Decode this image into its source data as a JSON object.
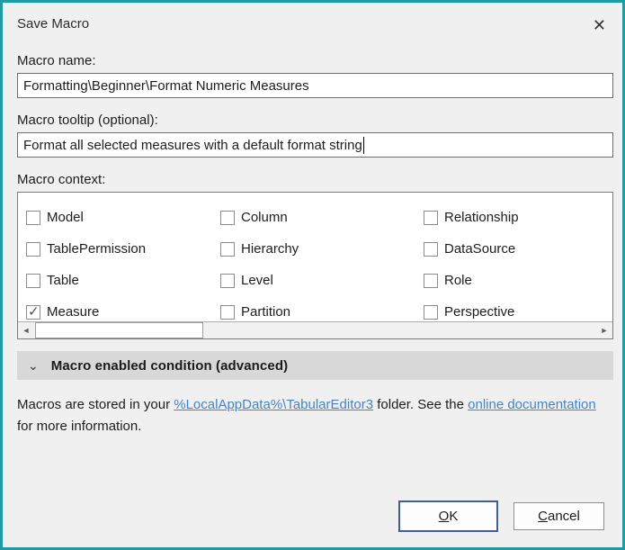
{
  "dialog": {
    "title": "Save Macro",
    "close_icon": "✕"
  },
  "macro_name": {
    "label": "Macro name:",
    "value": "Formatting\\Beginner\\Format Numeric Measures"
  },
  "macro_tooltip": {
    "label": "Macro tooltip (optional):",
    "value": "Format all selected measures with a default format string"
  },
  "context": {
    "label": "Macro context:",
    "check_icon": "✓",
    "scroll_left_icon": "◄",
    "scroll_right_icon": "►",
    "items": [
      {
        "label": "Model",
        "checked": false
      },
      {
        "label": "Column",
        "checked": false
      },
      {
        "label": "Relationship",
        "checked": false
      },
      {
        "label": "TablePermission",
        "checked": false
      },
      {
        "label": "Hierarchy",
        "checked": false
      },
      {
        "label": "DataSource",
        "checked": false
      },
      {
        "label": "Table",
        "checked": false
      },
      {
        "label": "Level",
        "checked": false
      },
      {
        "label": "Role",
        "checked": false
      },
      {
        "label": "Measure",
        "checked": true
      },
      {
        "label": "Partition",
        "checked": false
      },
      {
        "label": "Perspective",
        "checked": false
      }
    ]
  },
  "expander": {
    "chevron_icon": "⌄",
    "label": "Macro enabled condition (advanced)"
  },
  "footer_note": {
    "text_before": "Macros are stored in your ",
    "link_folder": "%LocalAppData%\\TabularEditor3",
    "text_mid": " folder. See the ",
    "link_docs": "online documentation",
    "text_after": " for more information."
  },
  "buttons": {
    "ok_accesskey": "O",
    "ok_rest": "K",
    "cancel_accesskey": "C",
    "cancel_rest": "ancel"
  },
  "colors": {
    "accent_teal": "#1f9ba1",
    "link_blue": "#4584c4",
    "ok_focus_border": "#3f5e94"
  }
}
